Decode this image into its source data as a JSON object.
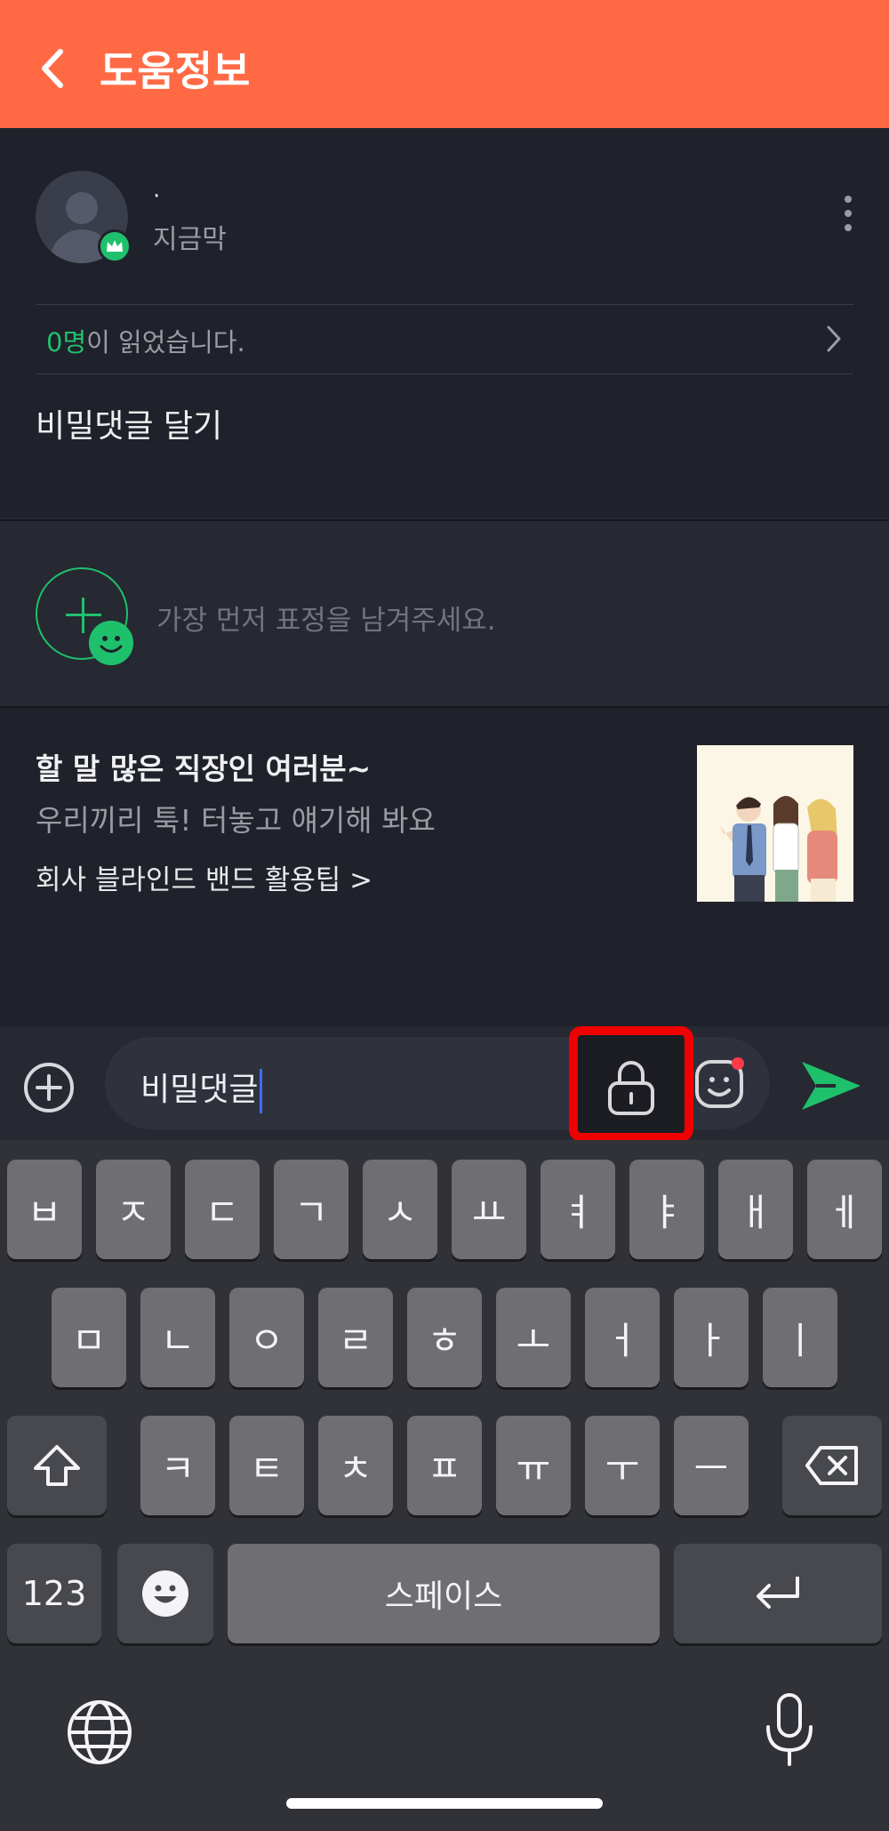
{
  "header": {
    "title": "도움정보"
  },
  "post": {
    "author": "·",
    "time": "지금막",
    "readers_count": "0명",
    "readers_suffix": "이 읽었습니다.",
    "content": "비밀댓글 달기"
  },
  "reaction": {
    "hint": "가장 먼저 표정을 남겨주세요."
  },
  "promo": {
    "title": "할 말 많은 직장인 여러분~",
    "subtitle": "우리끼리 툭! 터놓고 얘기해 봐요",
    "link": "회사 블라인드 밴드 활용팁 >"
  },
  "composer": {
    "value": "비밀댓글"
  },
  "keyboard": {
    "row1": [
      "ㅂ",
      "ㅈ",
      "ㄷ",
      "ㄱ",
      "ㅅ",
      "ㅛ",
      "ㅕ",
      "ㅑ",
      "ㅐ",
      "ㅔ"
    ],
    "row2": [
      "ㅁ",
      "ㄴ",
      "ㅇ",
      "ㄹ",
      "ㅎ",
      "ㅗ",
      "ㅓ",
      "ㅏ",
      "ㅣ"
    ],
    "row3": [
      "ㅋ",
      "ㅌ",
      "ㅊ",
      "ㅍ",
      "ㅠ",
      "ㅜ",
      "ㅡ"
    ],
    "numbers": "123",
    "space": "스페이스"
  },
  "colors": {
    "accent": "#ff6a45",
    "green": "#1fc06c",
    "highlight": "#f00000"
  }
}
